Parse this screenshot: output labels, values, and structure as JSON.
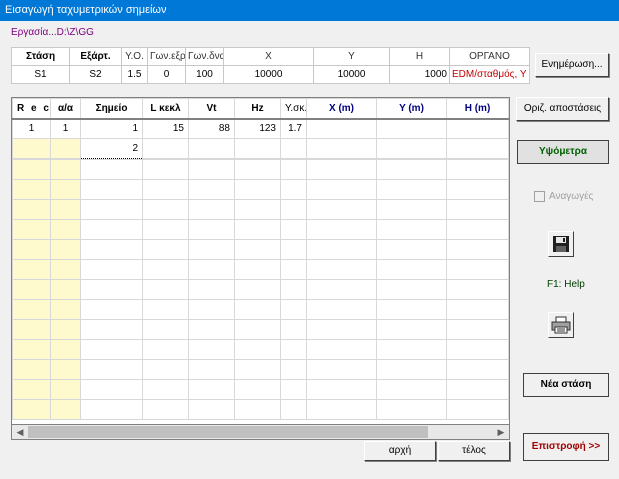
{
  "window": {
    "title": "Εισαγωγή ταχυμετρικών σημείων"
  },
  "path": "Εργασία...D:\\Z\\GG",
  "station": {
    "headers": [
      "Στάση",
      "Εξάρτ.",
      "Υ.Ο.",
      "Γων.εξρ",
      "Γων.δνα",
      "X",
      "Y",
      "H",
      "ΟΡΓΑΝΟ"
    ],
    "values": [
      "S1",
      "S2",
      "1.5",
      "0",
      "100",
      "10000",
      "10000",
      "1000",
      "EDM/σταθμός, Υ"
    ]
  },
  "buttons": {
    "update": "Ενημέρωση...",
    "set_distances": "Οριζ. αποστάσεις",
    "heights": "Υψόμετρα",
    "new_station": "Νέα στάση",
    "start": "αρχή",
    "end": "τέλος",
    "return": "Επιστροφή >>"
  },
  "reductions": {
    "label": "Αναγωγές",
    "checked": false
  },
  "help_text": "F1: Help",
  "grid": {
    "columns": [
      "R e c",
      "α/α",
      "Σημείο",
      "L κεκλ",
      "Vt",
      "Hz",
      "Y.σκ.",
      "X  (m)",
      "Y  (m)",
      "H  (m)"
    ],
    "rows": [
      [
        "1",
        "1",
        "1",
        "15",
        "88",
        "123",
        "1.7",
        "",
        "",
        ""
      ],
      [
        "",
        "",
        "2",
        "",
        "",
        "",
        "",
        "",
        "",
        ""
      ]
    ]
  },
  "icons": {
    "save": "floppy-disk-icon",
    "print": "printer-icon"
  }
}
